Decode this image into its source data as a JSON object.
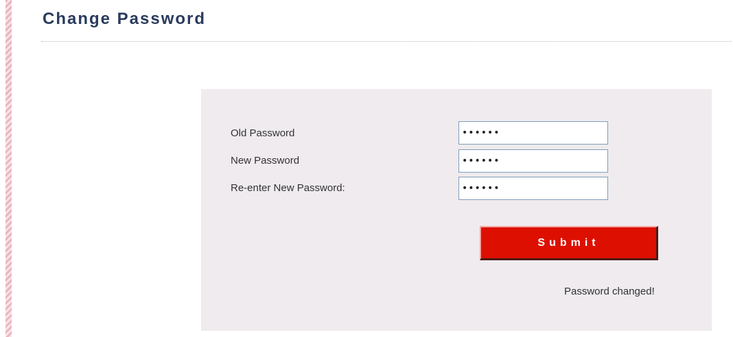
{
  "page": {
    "title": "Change Password"
  },
  "form": {
    "fields": [
      {
        "label": "Old Password",
        "value": "••••••"
      },
      {
        "label": "New Password",
        "value": "••••••"
      },
      {
        "label": "Re-enter New Password:",
        "value": "••••••"
      }
    ],
    "submit_label": "Submit",
    "status_message": "Password changed!"
  },
  "colors": {
    "title_text": "#2a3b5c",
    "panel_background": "#efebee",
    "submit_button": "#dd0f00",
    "input_border": "#7f9db9",
    "accent_stripe": "#e9b6bd"
  }
}
